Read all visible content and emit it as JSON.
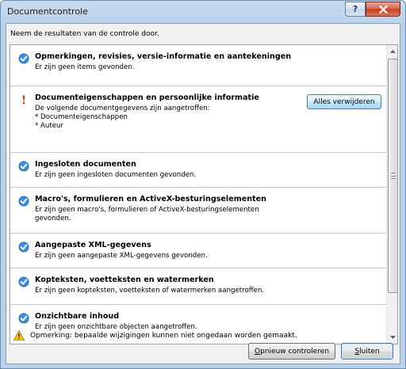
{
  "window": {
    "title": "Documentcontrole",
    "help_label": "?",
    "close_label": "X"
  },
  "instruction": "Neem de resultaten van de controle door.",
  "items": [
    {
      "status": "ok",
      "title": "Opmerkingen, revisies, versie-informatie en aantekeningen",
      "desc": "Er zijn geen items gevonden."
    },
    {
      "status": "warning",
      "title": "Documenteigenschappen en persoonlijke informatie",
      "desc_lines": [
        "De volgende documentgegevens zijn aangetroffen:",
        "* Documenteigenschappen",
        "* Auteur"
      ],
      "action_label": "Alles verwijderen"
    },
    {
      "status": "ok",
      "title": "Ingesloten documenten",
      "desc": "Er zijn geen ingesloten documenten gevonden."
    },
    {
      "status": "ok",
      "title": "Macro's, formulieren en ActiveX-besturingselementen",
      "desc_lines": [
        "Er zijn geen macro's, formulieren of ActiveX-besturingselementen",
        "gevonden."
      ]
    },
    {
      "status": "ok",
      "title": "Aangepaste XML-gegevens",
      "desc": "Er zijn geen aangepaste XML-gegevens gevonden."
    },
    {
      "status": "ok",
      "title": "Kopteksten, voetteksten en watermerken",
      "desc": "Er zijn geen kopteksten, voetteksten of watermerken aangetroffen."
    },
    {
      "status": "ok",
      "title": "Onzichtbare inhoud",
      "desc": "Er zijn geen onzichtbare objecten aangetroffen."
    }
  ],
  "note": "Opmerking: bepaalde wijzigingen kunnen niet ongedaan worden gemaakt.",
  "buttons": {
    "recheck_pre": "",
    "recheck_key": "O",
    "recheck_post": "pnieuw controleren",
    "close_pre": "",
    "close_key": "S",
    "close_post": "luiten"
  },
  "colors": {
    "check_blue": "#1f6fc5",
    "warning_red": "#d8381a"
  }
}
